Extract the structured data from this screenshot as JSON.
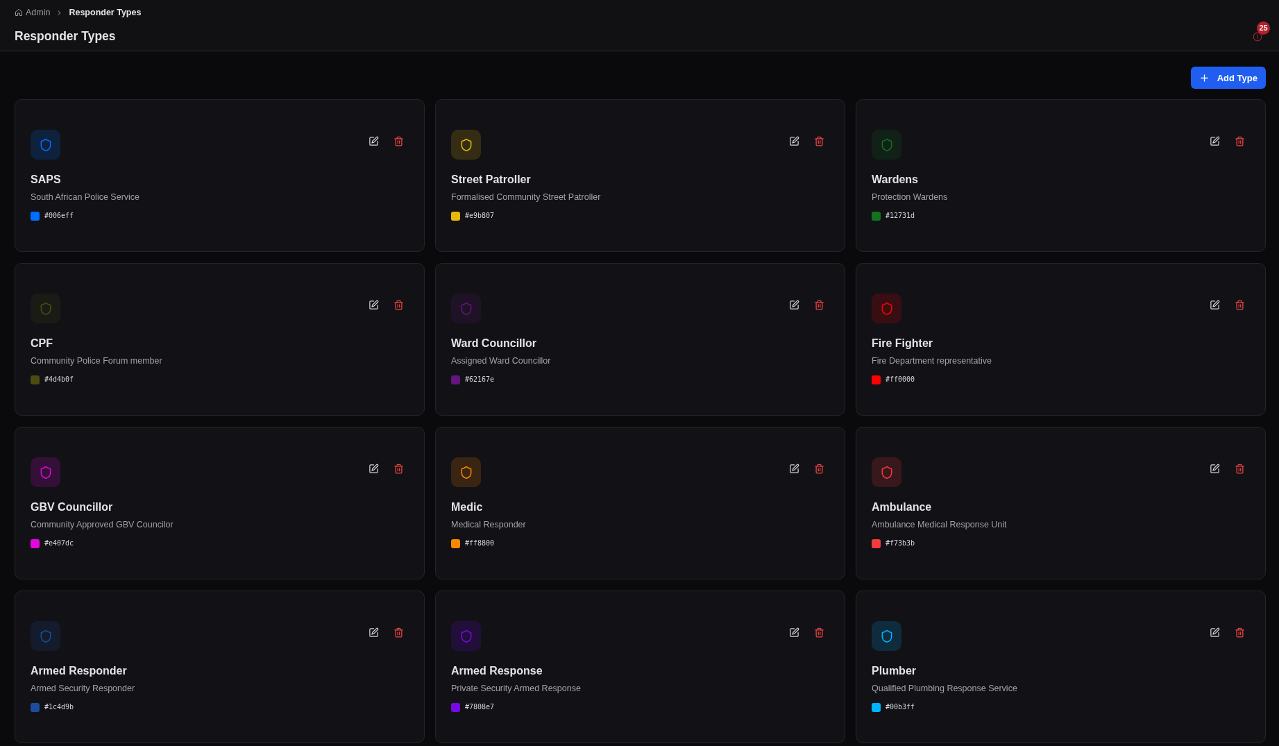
{
  "breadcrumb": {
    "items": [
      {
        "label": "Admin",
        "kind": "home"
      },
      {
        "label": "Responder Types",
        "kind": "current"
      }
    ]
  },
  "page_title": "Responder Types",
  "notifications": {
    "count": "25"
  },
  "add_button": {
    "label": "Add Type"
  },
  "types": [
    {
      "name": "SAPS",
      "description": "South African Police Service",
      "code": "#006eff",
      "color": "#006eff"
    },
    {
      "name": "Street Patroller",
      "description": "Formalised Community Street Patroller",
      "code": "#e9b807",
      "color": "#e9b807"
    },
    {
      "name": "Wardens",
      "description": "Protection Wardens",
      "code": "#12731d",
      "color": "#12731d"
    },
    {
      "name": "CPF",
      "description": "Community Police Forum member",
      "code": "#4d4b0f",
      "color": "#4d4b0f"
    },
    {
      "name": "Ward Councillor",
      "description": "Assigned Ward Councillor",
      "code": "#62167e",
      "color": "#62167e"
    },
    {
      "name": "Fire Fighter",
      "description": "Fire Department representative",
      "code": "#ff0000",
      "color": "#ff0000"
    },
    {
      "name": "GBV Councillor",
      "description": "Community Approved GBV Councilor",
      "code": "#e407dc",
      "color": "#e407dc"
    },
    {
      "name": "Medic",
      "description": "Medical Responder",
      "code": "#ff8800",
      "color": "#ff8800"
    },
    {
      "name": "Ambulance",
      "description": "Ambulance Medical Response Unit",
      "code": "#f73b3b",
      "color": "#f73b3b"
    },
    {
      "name": "Armed Responder",
      "description": "Armed Security Responder",
      "code": "#1c4d9b",
      "color": "#1c4d9b"
    },
    {
      "name": "Armed Response",
      "description": "Private Security Armed Response",
      "code": "#7808e7",
      "color": "#7808e7"
    },
    {
      "name": "Plumber",
      "description": "Qualified Plumbing Response Service",
      "code": "#00b3ff",
      "color": "#00b3ff"
    }
  ]
}
